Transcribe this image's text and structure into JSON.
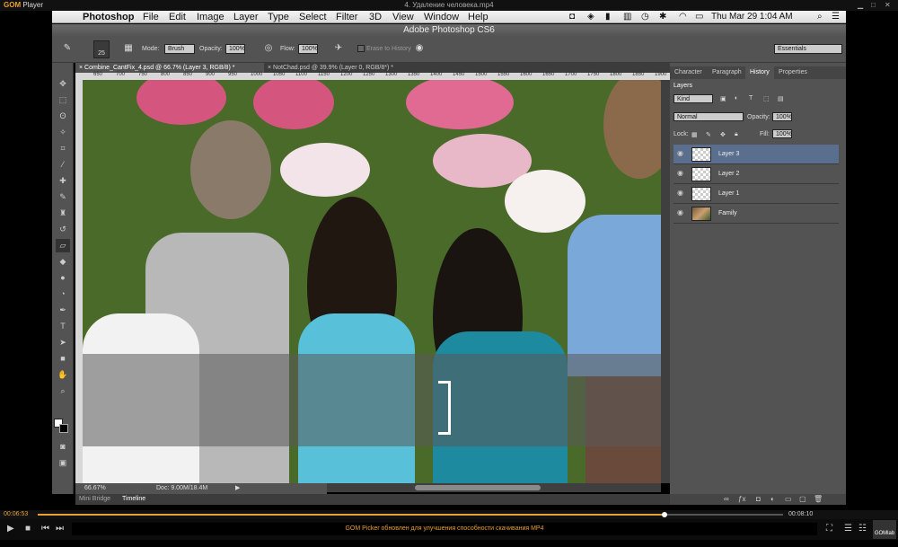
{
  "player": {
    "logo": "GOM",
    "logo2": "Player",
    "title": "4. Удаление человека.mp4",
    "elapsed": "00:06:53",
    "total": "00:08:10",
    "notice": "GOM Picker обновлен для улучшения способности скачивания MP4",
    "gomlab": "GOMlab"
  },
  "menubar": {
    "app": "Photoshop",
    "items": [
      "File",
      "Edit",
      "Image",
      "Layer",
      "Type",
      "Select",
      "Filter",
      "3D",
      "View",
      "Window",
      "Help"
    ],
    "clock": "Thu Mar 29  1:04 AM"
  },
  "ps": {
    "title": "Adobe Photoshop CS6"
  },
  "options": {
    "brush_size": "25",
    "mode_label": "Mode:",
    "mode": "Brush",
    "opacity_label": "Opacity:",
    "opacity": "100%",
    "flow_label": "Flow:",
    "flow": "100%",
    "erase_history": "Erase to History",
    "workspace": "Essentials"
  },
  "tabs": [
    "Combine_CantFix_4.psd @ 66.7% (Layer 3, RGB/8) *",
    "NotChad.psd @ 39.9% (Layer 0, RGB/8*) *"
  ],
  "ruler": [
    "650",
    "700",
    "750",
    "800",
    "850",
    "900",
    "950",
    "1000",
    "1050",
    "1100",
    "1150",
    "1200",
    "1250",
    "1300",
    "1350",
    "1400",
    "1450",
    "1500",
    "1550",
    "1600",
    "1650",
    "1700",
    "1750",
    "1800",
    "1850",
    "1900"
  ],
  "status": {
    "zoom": "66.67%",
    "doc": "Doc: 9.00M/18.4M"
  },
  "bottom_tabs": [
    "Mini Bridge",
    "Timeline"
  ],
  "panel": {
    "tabs": [
      "Character",
      "Paragraph",
      "History",
      "Properties"
    ],
    "active_tab": "History",
    "layers_title": "Layers",
    "kind": "Kind",
    "blend": "Normal",
    "opacity_label": "Opacity:",
    "opacity": "100%",
    "lock_label": "Lock:",
    "fill_label": "Fill:",
    "fill": "100%",
    "layers": [
      "Layer 3",
      "Layer 2",
      "Layer 1",
      "Family"
    ]
  }
}
